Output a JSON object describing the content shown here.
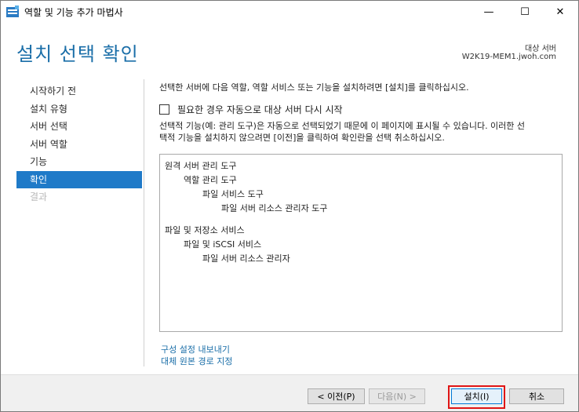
{
  "window": {
    "title": "역할 및 기능 추가 마법사",
    "minimize_glyph": "—",
    "maximize_glyph": "☐",
    "close_glyph": "✕"
  },
  "header": {
    "title": "설치 선택 확인",
    "destination_label": "대상 서버",
    "destination_server": "W2K19-MEM1.jwoh.com"
  },
  "nav": {
    "items": [
      {
        "label": "시작하기 전",
        "state": "normal"
      },
      {
        "label": "설치 유형",
        "state": "normal"
      },
      {
        "label": "서버 선택",
        "state": "normal"
      },
      {
        "label": "서버 역할",
        "state": "normal"
      },
      {
        "label": "기능",
        "state": "normal"
      },
      {
        "label": "확인",
        "state": "active"
      },
      {
        "label": "결과",
        "state": "disabled"
      }
    ]
  },
  "main": {
    "instruction": "선택한 서버에 다음 역할, 역할 서비스 또는 기능을 설치하려면 [설치]를 클릭하십시오.",
    "restart_label": "필요한 경우 자동으로 대상 서버 다시 시작",
    "restart_checked": false,
    "note_line1": "선택적 기능(예: 관리 도구)은 자동으로 선택되었기 때문에 이 페이지에 표시될 수 있습니다. 이러한 선",
    "note_line2": "택적 기능을 설치하지 않으려면 [이전]을 클릭하여 확인란을 선택 취소하십시오.",
    "features": [
      {
        "label": "원격 서버 관리 도구",
        "level": 0
      },
      {
        "label": "역할 관리 도구",
        "level": 1
      },
      {
        "label": "파일 서비스 도구",
        "level": 2
      },
      {
        "label": "파일 서버 리소스 관리자 도구",
        "level": 3
      },
      {
        "label": "파일 및 저장소 서비스",
        "level": 0
      },
      {
        "label": "파일 및 iSCSI 서비스",
        "level": 1
      },
      {
        "label": "파일 서버 리소스 관리자",
        "level": 2
      }
    ],
    "export_link": "구성 설정 내보내기",
    "alternate_source_link": "대체 원본 경로 지정"
  },
  "footer": {
    "prev_label": "< 이전(P)",
    "next_label": "다음(N) >",
    "install_label": "설치(I)",
    "cancel_label": "취소"
  },
  "colors": {
    "accent": "#1a6ea8",
    "nav_active": "#1f7ac8",
    "highlight": "#e01515"
  }
}
